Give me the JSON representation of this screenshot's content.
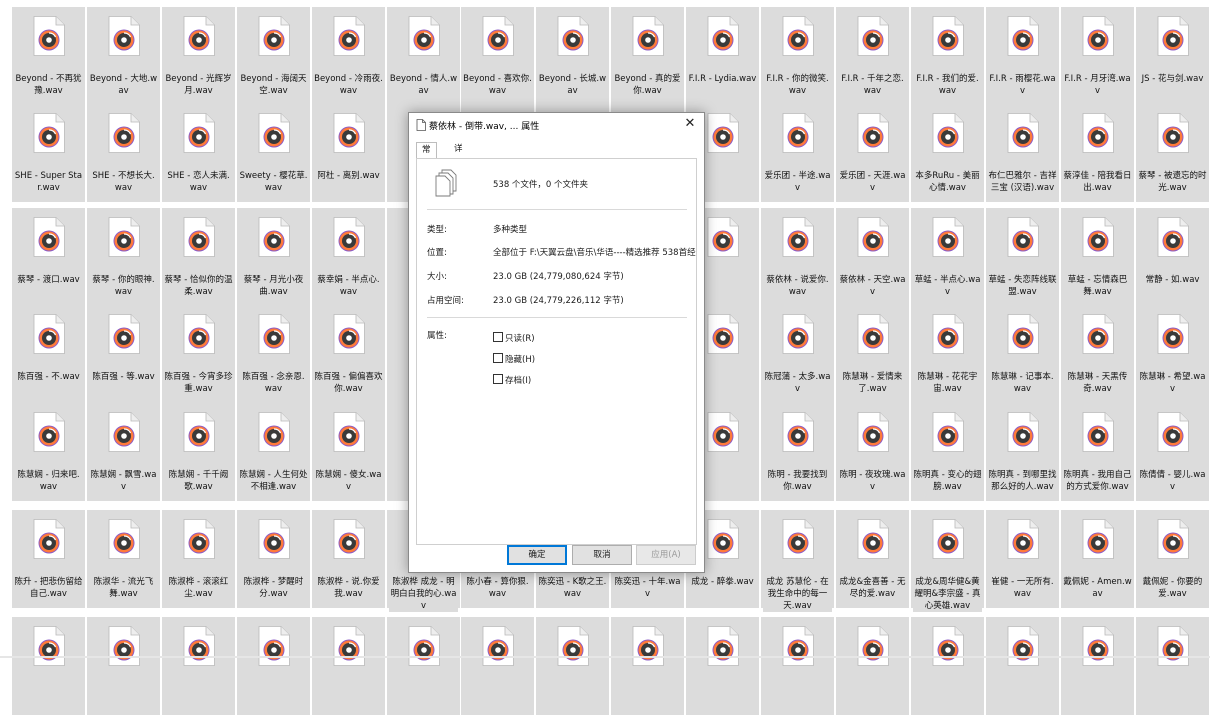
{
  "files": [
    [
      "Beyond - 不再犹豫.wav",
      "Beyond - 大地.wav",
      "Beyond - 光辉岁月.wav",
      "Beyond - 海阔天空.wav",
      "Beyond - 冷雨夜.wav",
      "Beyond - 情人.wav",
      "Beyond - 喜欢你.wav",
      "Beyond - 长城.wav",
      "Beyond - 真的爱你.wav",
      "F.I.R - Lydia.wav",
      "F.I.R - 你的微笑.wav",
      "F.I.R - 千年之恋.wav",
      "F.I.R - 我们的爱.wav",
      "F.I.R - 雨樱花.wav",
      "F.I.R - 月牙湾.wav",
      "JS - 花与剑.wav"
    ],
    [
      "SHE - Super Star.wav",
      "SHE - 不想长大.wav",
      "SHE - 恋人未满.wav",
      "Sweety - 樱花草.wav",
      "阿杜 - 离别.wav",
      "",
      "",
      "",
      "",
      "",
      "爱乐团 - 半途.wav",
      "爱乐团 - 天涯.wav",
      "本多RuRu - 美丽心情.wav",
      "布仁巴雅尔 - 吉祥三宝 (汉语).wav",
      "蔡淳佳 - 陪我看日出.wav",
      "蔡琴 - 被遗忘的时光.wav"
    ],
    [
      "蔡琴 - 渡口.wav",
      "蔡琴 - 你的眼神.wav",
      "蔡琴 - 恰似你的温柔.wav",
      "蔡琴 - 月光小夜曲.wav",
      "蔡幸娟 - 半点心.wav",
      "",
      "",
      "",
      "",
      "",
      "蔡依林 - 说爱你.wav",
      "蔡依林 - 天空.wav",
      "草蜢 - 半点心.wav",
      "草蜢 - 失恋阵线联盟.wav",
      "草蜢 - 忘情森巴舞.wav",
      "常静 - 如.wav"
    ],
    [
      "陈百强 - 不.wav",
      "陈百强 - 等.wav",
      "陈百强 - 今宵多珍重.wav",
      "陈百强 - 念亲恩.wav",
      "陈百强 - 偏偏喜欢你.wav",
      "",
      "",
      "",
      "",
      "",
      "陈冠蒲 - 太多.wav",
      "陈慧琳 - 爱情来了.wav",
      "陈慧琳 - 花花宇宙.wav",
      "陈慧琳 - 记事本.wav",
      "陈慧琳 - 天黑传奇.wav",
      "陈慧琳 - 希望.wav"
    ],
    [
      "陈慧娴 - 归来吧.wav",
      "陈慧娴 - 飘雪.wav",
      "陈慧娴 - 千千阙歌.wav",
      "陈慧娴 - 人生何处不相逢.wav",
      "陈慧娴 - 傻女.wav",
      "",
      "",
      "",
      "",
      "",
      "陈明 - 我要找到你.wav",
      "陈明 - 夜玫瑰.wav",
      "陈明真 - 变心的翅膀.wav",
      "陈明真 - 到哪里找那么好的人.wav",
      "陈明真 - 我用自己的方式爱你.wav",
      "陈倩倩 - 婴儿.wav"
    ],
    [
      "陈升 - 把悲伤留给自己.wav",
      "陈淑华 - 流光飞舞.wav",
      "陈淑桦 - 滚滚红尘.wav",
      "陈淑桦 - 梦醒时分.wav",
      "陈淑桦 - 说.你爱我.wav",
      "陈淑桦 成龙 - 明明白白我的心.wav",
      "陈小春 - 算你狠.wav",
      "陈奕迅 - K歌之王.wav",
      "陈奕迅 - 十年.wav",
      "成龙 - 醉拳.wav",
      "成龙 苏慧伦 - 在我生命中的每一天.wav",
      "成龙&金喜善 - 无尽的爱.wav",
      "成龙&周华健&黄耀明&李宗盛 - 真心英雄.wav",
      "崔健 - 一无所有.wav",
      "戴佩妮 - Amen.wav",
      "戴佩妮 - 你要的爱.wav"
    ],
    [
      "",
      "",
      "",
      "",
      "",
      "",
      "",
      "",
      "",
      "",
      "",
      "",
      "",
      "",
      "",
      ""
    ]
  ],
  "dialog": {
    "title": "蔡依林 - 倒带.wav, ... 属性",
    "close_glyph": "✕",
    "tab_general": "常规",
    "tab_details": "详细信息",
    "summary": "538 个文件，0 个文件夹",
    "type_label": "类型:",
    "type_value": "多种类型",
    "location_label": "位置:",
    "location_value": "全部位于 F:\\天翼云盘\\音乐\\华语----精选推荐 538首经",
    "size_label": "大小:",
    "size_value": "23.0 GB (24,779,080,624 字节)",
    "disk_label": "占用空间:",
    "disk_value": "23.0 GB (24,779,226,112 字节)",
    "attr_label": "属性:",
    "readonly": "只读(R)",
    "hidden": "隐藏(H)",
    "archive": "存档(I)",
    "ok": "确定",
    "cancel": "取消",
    "apply": "应用(A)"
  },
  "icons": {
    "file": "music-file-icon",
    "dialog": "properties-icon",
    "multi": "multiple-files-icon"
  },
  "colors": {
    "disc_outer": "#ff7a3a",
    "disc_rim": "#8a5cc7",
    "tile_bg": "#dcdcdc",
    "accent": "#0078d7"
  }
}
